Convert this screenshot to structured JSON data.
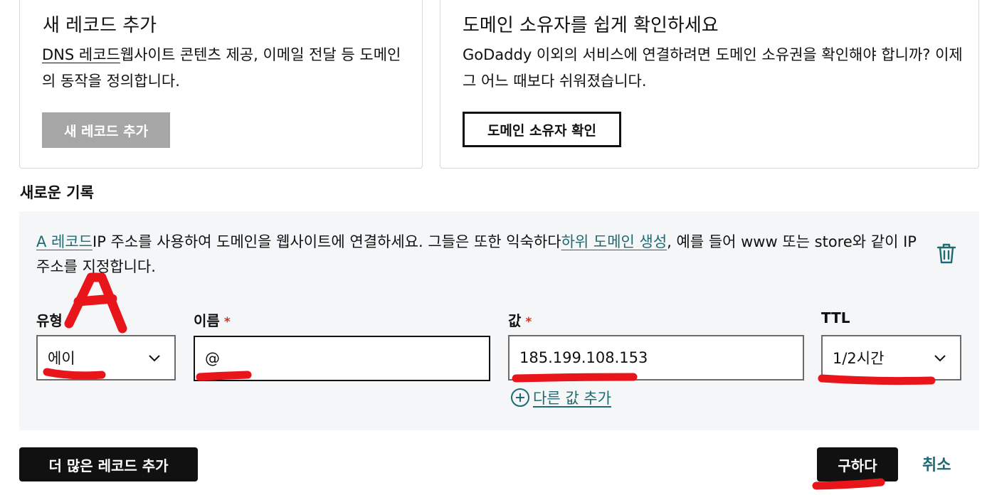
{
  "add_record_card": {
    "title": "새 레코드 추가",
    "desc_link": "DNS 레코드",
    "desc_rest": "웹사이트 콘텐츠 제공, 이메일 전달 등 도메인의 동작을 정의합니다.",
    "button": "새 레코드 추가"
  },
  "verify_card": {
    "title": "도메인 소유자를 쉽게 확인하세요",
    "desc": "GoDaddy 이외의 서비스에 연결하려면 도메인 소유권을 확인해야 합니까? 이제 그 어느 때보다 쉬워졌습니다.",
    "button": "도메인 소유자 확인"
  },
  "new_record": {
    "section_title": "새로운 기록",
    "desc_link1": "A 레코드",
    "desc_part1": "IP 주소를 사용하여 도메인을 웹사이트에 연결하세요. 그들은 또한 익숙하다",
    "desc_link2": "하위 도메인 생성",
    "desc_part2": ", 예를 들어 www 또는 store와 같이 IP 주소를 지정합니다.",
    "delete_icon": "trash-icon",
    "fields": {
      "type_label": "유형",
      "type_value": "에이",
      "name_label": "이름",
      "name_value": "@",
      "value_label": "값",
      "value_value": "185.199.108.153",
      "ttl_label": "TTL",
      "ttl_value": "1/2시간",
      "required_mark": "*"
    },
    "add_value_link": "다른 값 추가"
  },
  "footer": {
    "add_more": "더 많은 레코드 추가",
    "save": "구하다",
    "cancel": "취소"
  },
  "annotation": {
    "letter": "A",
    "color": "#e8161b"
  },
  "colors": {
    "teal_link": "#1f6b73",
    "panel_bg": "#f4f6f8",
    "dark_button": "#111111",
    "disabled_button": "#a6a6a6"
  }
}
